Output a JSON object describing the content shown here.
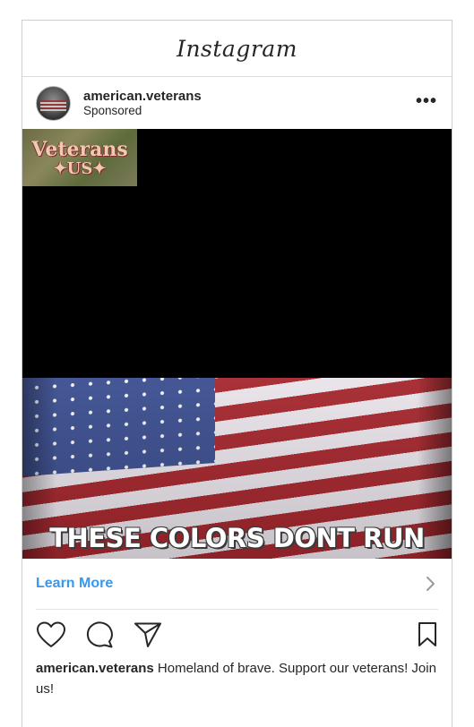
{
  "app": {
    "title": "Instagram"
  },
  "post": {
    "username": "american.veterans",
    "subtitle": "Sponsored",
    "more_label": "•••",
    "media": {
      "badge_line1": "Veterans",
      "badge_line2": "✦US✦",
      "overlay_text": "THESE COLORS DONT RUN"
    },
    "cta": {
      "label": "Learn More"
    },
    "caption": {
      "username": "american.veterans",
      "text": "Homeland of brave. Support our veterans! Join us!"
    }
  },
  "icons": [
    "heart-icon",
    "comment-icon",
    "share-icon",
    "bookmark-icon",
    "chevron-right-icon"
  ],
  "colors": {
    "link": "#3897f0",
    "text": "#262626",
    "border": "#dbdbdb"
  }
}
